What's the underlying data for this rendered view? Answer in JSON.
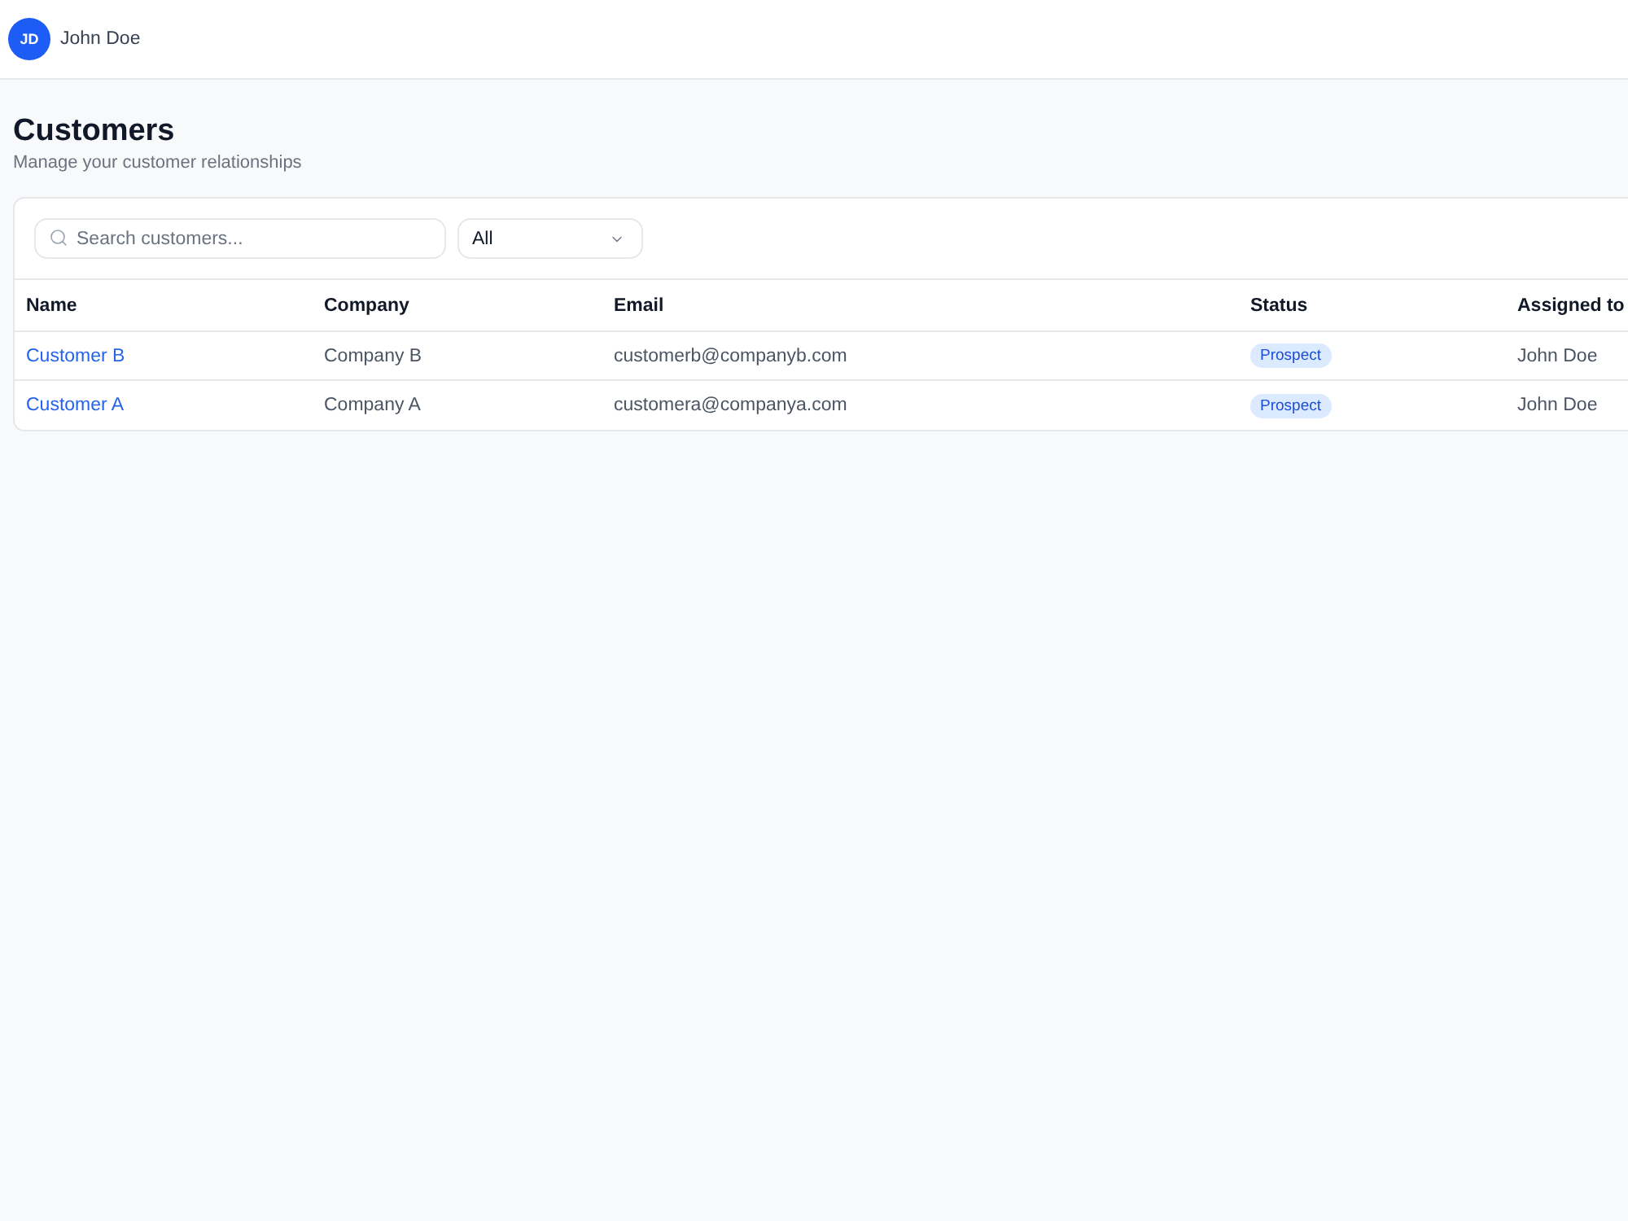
{
  "header": {
    "user": {
      "initials": "JD",
      "name": "John Doe"
    }
  },
  "page": {
    "title": "Customers",
    "subtitle": "Manage your customer relationships"
  },
  "toolbar": {
    "search": {
      "placeholder": "Search customers..."
    },
    "filter": {
      "value": "All"
    }
  },
  "table": {
    "columns": [
      "Name",
      "Company",
      "Email",
      "Status",
      "Assigned to"
    ],
    "rows": [
      {
        "name": "Customer B",
        "company": "Company B",
        "email": "customerb@companyb.com",
        "status": "Prospect",
        "assigned_to": "John Doe"
      },
      {
        "name": "Customer A",
        "company": "Company A",
        "email": "customera@companya.com",
        "status": "Prospect",
        "assigned_to": "John Doe"
      }
    ]
  }
}
